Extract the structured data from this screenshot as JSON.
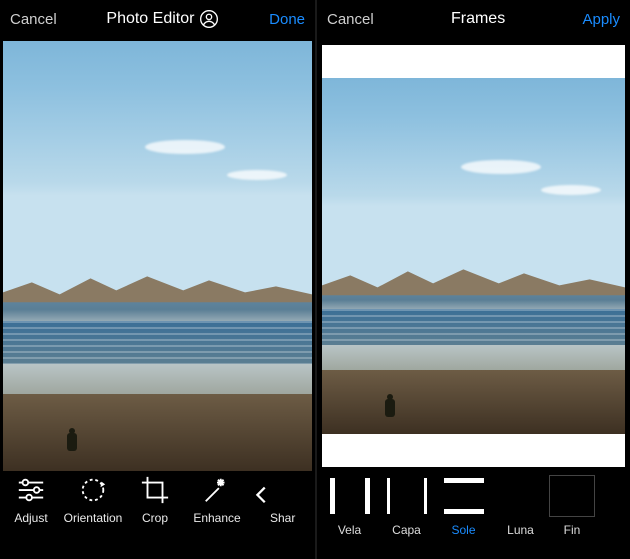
{
  "left": {
    "cancel": "Cancel",
    "title": "Photo Editor",
    "done": "Done",
    "tools": {
      "adjust": "Adjust",
      "orientation": "Orientation",
      "crop": "Crop",
      "enhance": "Enhance",
      "sharp": "Shar"
    }
  },
  "right": {
    "cancel": "Cancel",
    "title": "Frames",
    "apply": "Apply",
    "frame_options": {
      "vela": "Vela",
      "capa": "Capa",
      "sole": "Sole",
      "luna": "Luna",
      "fine": "Fin"
    },
    "selected": "Sole"
  }
}
